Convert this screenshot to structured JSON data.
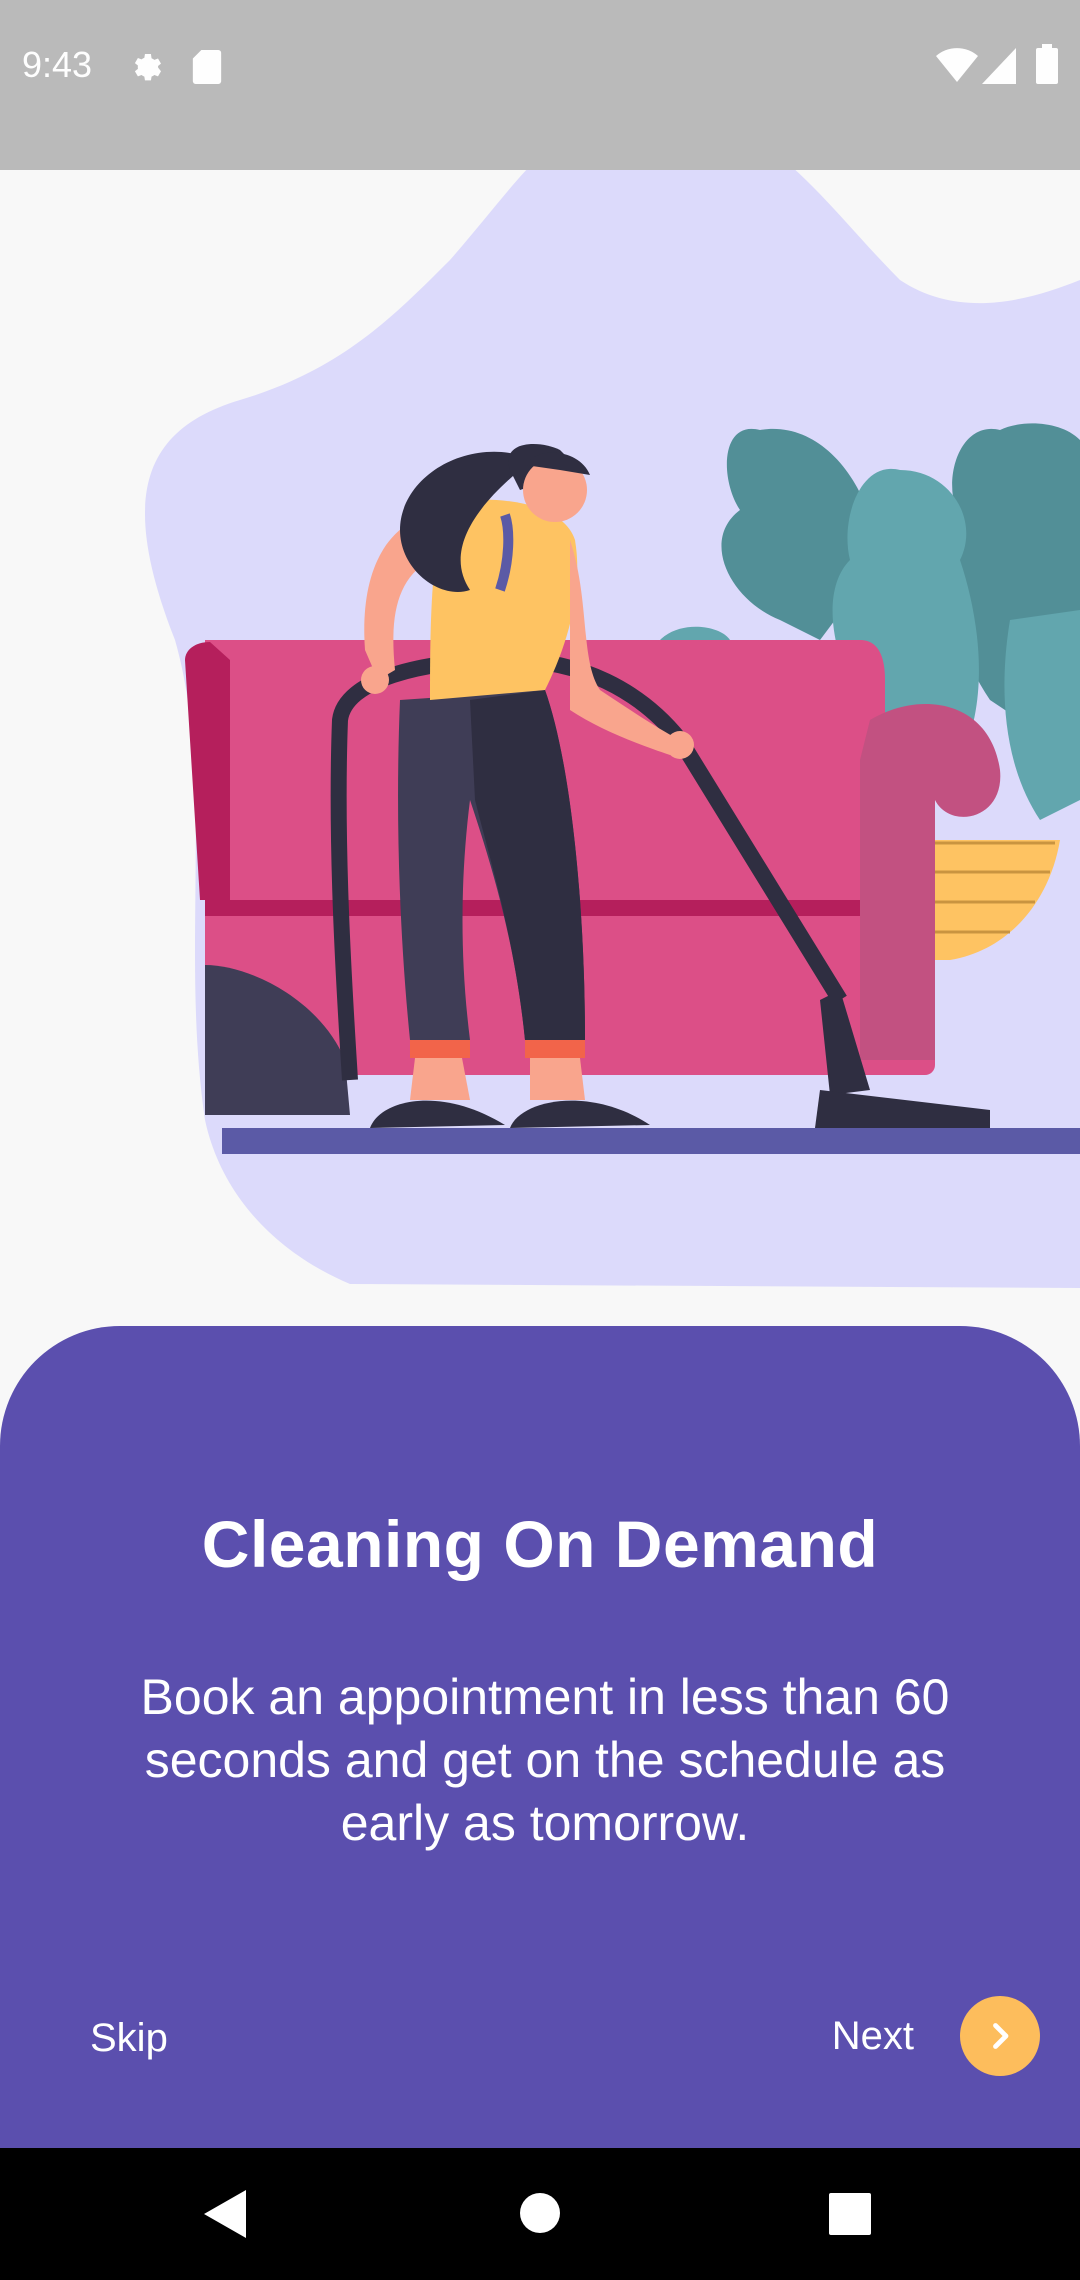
{
  "status_bar": {
    "time": "9:43",
    "icons": [
      "settings-icon",
      "sd-card-icon",
      "wifi-icon",
      "cellular-signal-icon",
      "battery-icon"
    ]
  },
  "onboarding": {
    "title": "Cleaning On Demand",
    "description": "Book an appointment in less than 60 seconds and get on the schedule as early as tomorrow.",
    "skip_label": "Skip",
    "next_label": "Next",
    "next_icon": "chevron-right-icon"
  },
  "nav_bar": {
    "buttons": [
      "back-triangle-icon",
      "home-circle-icon",
      "recents-square-icon"
    ]
  },
  "colors": {
    "card": "#5b4fae",
    "accent": "#fdbd5c",
    "blob": "#dcdafb",
    "sofa": "#dc4f87"
  }
}
